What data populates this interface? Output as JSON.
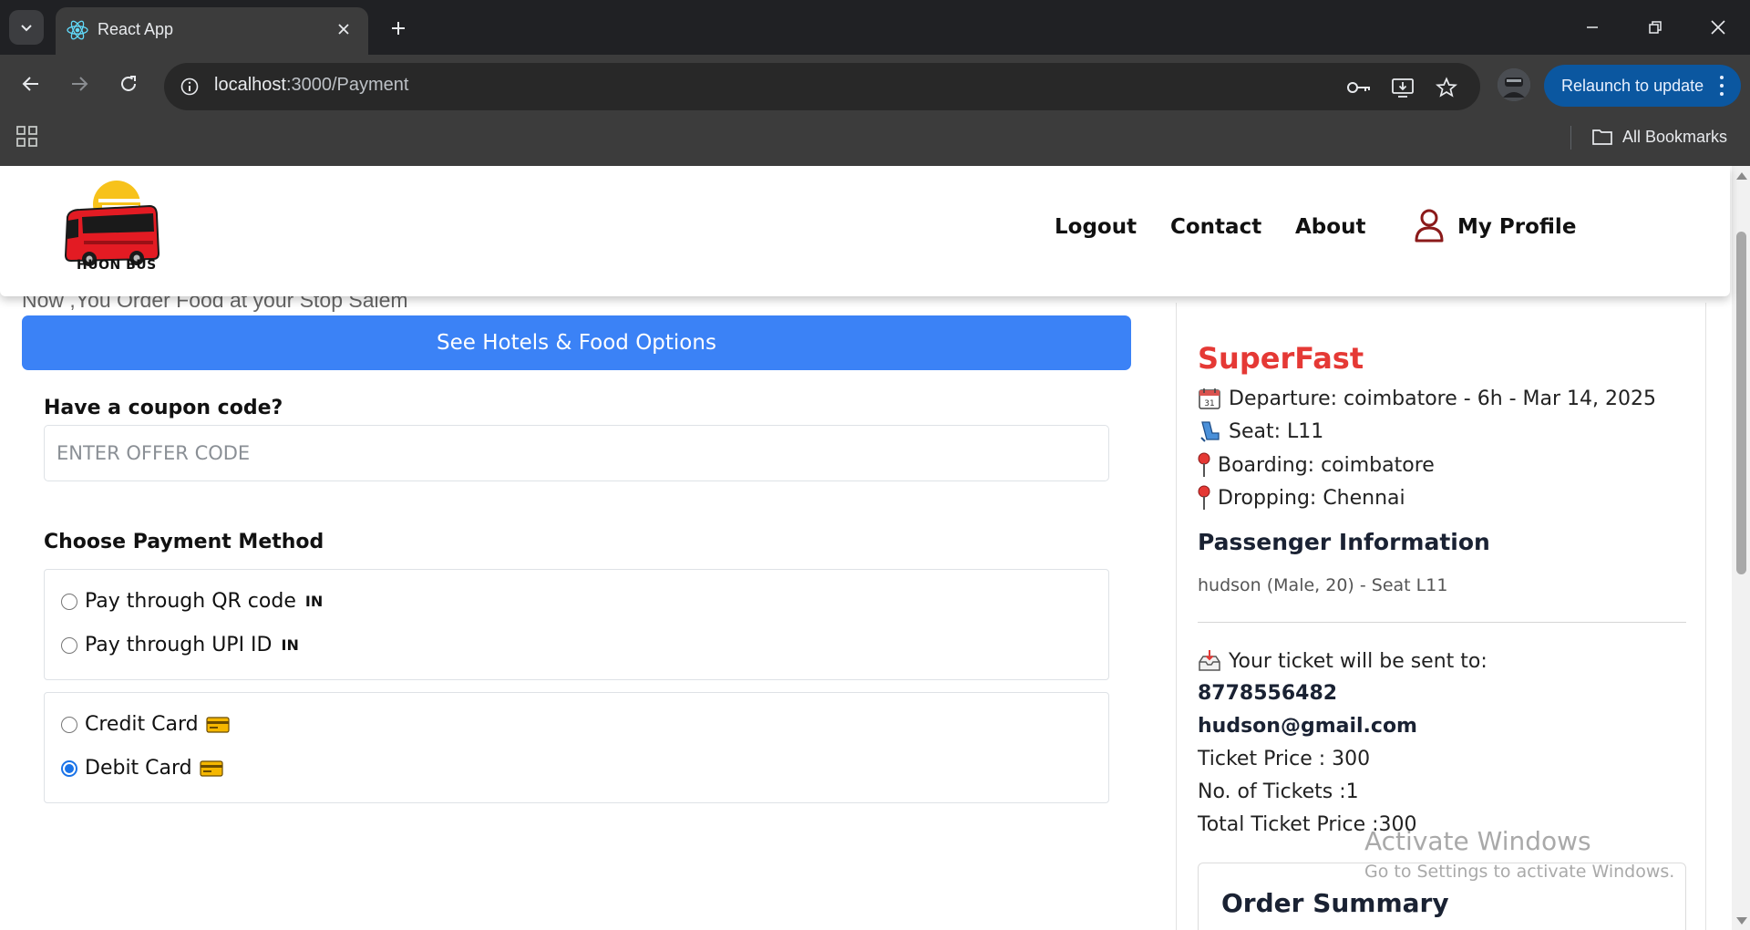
{
  "browser": {
    "tab_title": "React App",
    "url_host": "localhost",
    "url_path": ":3000/Payment",
    "relaunch_label": "Relaunch to update",
    "all_bookmarks_label": "All Bookmarks"
  },
  "site": {
    "logo_text": "HUON BUS",
    "nav": {
      "logout": "Logout",
      "contact": "Contact",
      "about": "About",
      "profile": "My Profile"
    }
  },
  "left": {
    "food_tagline": "Now ,You Order Food at your Stop Salem",
    "hotels_button": "See Hotels & Food Options",
    "coupon_label": "Have a coupon code?",
    "coupon_placeholder": "ENTER OFFER CODE",
    "coupon_value": "",
    "payment_title": "Choose Payment Method",
    "payment_options": [
      {
        "label": "Pay through QR code",
        "badge": "IN",
        "selected": false
      },
      {
        "label": "Pay through UPI ID",
        "badge": "IN",
        "selected": false
      },
      {
        "label": "Credit Card",
        "icon": "credit-card-icon",
        "selected": false
      },
      {
        "label": "Debit Card",
        "icon": "credit-card-icon",
        "selected": true
      }
    ]
  },
  "right": {
    "bus_name": "SuperFast",
    "departure": "Departure: coimbatore - 6h - Mar 14, 2025",
    "seat": "Seat: L11",
    "boarding": "Boarding: coimbatore",
    "dropping": "Dropping: Chennai",
    "passenger_title": "Passenger Information",
    "passenger_info": "hudson (Male, 20) - Seat L11",
    "ticket_sent_label": "Your ticket will be sent to:",
    "phone": "8778556482",
    "email": "hudson@gmail.com",
    "ticket_price": "Ticket Price : 300",
    "ticket_count": "No. of Tickets :1",
    "total_price": "Total Ticket Price :300",
    "order_summary_title": "Order Summary"
  },
  "watermark": {
    "title": "Activate Windows",
    "subtitle": "Go to Settings to activate Windows."
  },
  "colors": {
    "accent_blue": "#3b82f6",
    "bus_name_red": "#e53935",
    "chrome_dark": "#202124",
    "chrome_toolbar": "#3c3c3c",
    "relaunch_blue": "#0b57a0"
  }
}
